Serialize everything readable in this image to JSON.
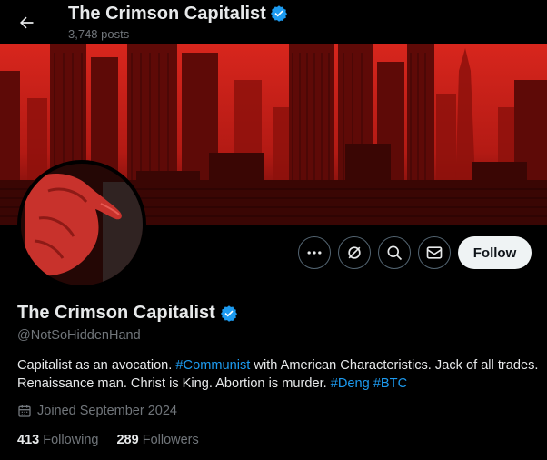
{
  "header": {
    "back_label": "Back",
    "title": "The Crimson Capitalist",
    "post_count": "3,748 posts"
  },
  "actions": {
    "more_icon": "ellipsis-icon",
    "grok_icon": "grok-icon",
    "search_icon": "search-icon",
    "message_icon": "mail-icon",
    "follow_label": "Follow"
  },
  "profile": {
    "name": "The Crimson Capitalist",
    "handle": "@NotSoHiddenHand",
    "verified": true,
    "verified_color": "#1d9bf0",
    "bio": {
      "t1": "Capitalist as an avocation. ",
      "tag1": "#Communist",
      "t2": " with American Characteristics. Jack of all trades. Renaissance man. Christ is King. Abortion is murder. ",
      "tag2": "#Deng",
      "t3": " ",
      "tag3": "#BTC"
    },
    "joined": "Joined September 2024",
    "following_count": "413",
    "following_label": "Following",
    "followers_count": "289",
    "followers_label": "Followers"
  },
  "colors": {
    "accent": "#1d9bf0",
    "banner_red": "#c3201a",
    "background": "#000000"
  }
}
